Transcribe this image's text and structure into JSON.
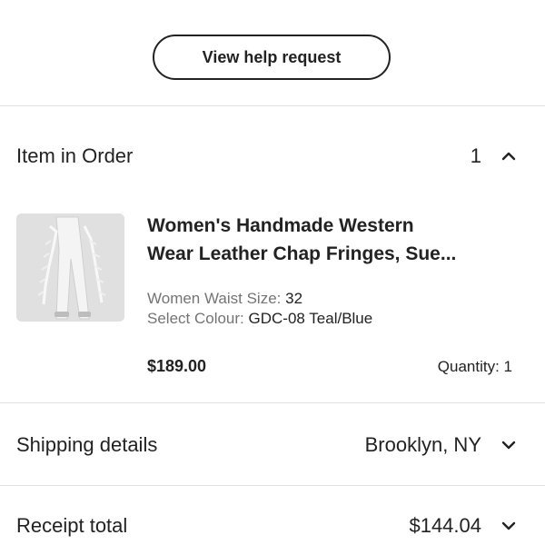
{
  "help_button": {
    "label": "View help request"
  },
  "order_items": {
    "title": "Item in Order",
    "count": "1"
  },
  "item": {
    "thumbnail_icon": "product-thumbnail",
    "title_line1": "Women's Handmade Western",
    "title_line2": "Wear Leather Chap Fringes, Sue...",
    "variations": [
      {
        "label": "Women Waist Size:",
        "value": "32"
      },
      {
        "label": "Select Colour:",
        "value": "GDC-08 Teal/Blue"
      }
    ],
    "price": "$189.00",
    "quantity": "Quantity: 1"
  },
  "shipping": {
    "label": "Shipping details",
    "value": "Brooklyn, NY"
  },
  "receipt": {
    "label": "Receipt total",
    "value": "$144.04"
  },
  "colors": {
    "text": "#222222",
    "muted": "#747474",
    "divider": "#e1e1e1"
  }
}
